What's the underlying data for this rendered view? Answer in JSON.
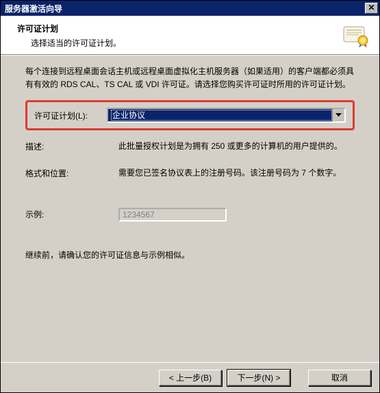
{
  "window": {
    "title": "服务器激活向导",
    "close": "✕"
  },
  "header": {
    "title": "许可证计划",
    "subtitle": "选择适当的许可证计划。"
  },
  "intro": "每个连接到远程桌面会话主机或远程桌面虚拟化主机服务器（如果适用）的客户端都必须具有有效的 RDS CAL、TS CAL 或 VDI 许可证。请选择您购买许可证时所用的许可证计划。",
  "licensePlan": {
    "label": "许可证计划(L):",
    "selected": "企业协议"
  },
  "description": {
    "label": "描述:",
    "value": "此批量授权计划是为拥有 250 或更多的计算机的用户提供的。"
  },
  "format": {
    "label": "格式和位置:",
    "value": "需要您已签名协议表上的注册号码。该注册号码为 7 个数字。"
  },
  "example": {
    "label": "示例:",
    "value": "1234567"
  },
  "confirm": "继续前，请确认您的许可证信息与示例相似。",
  "buttons": {
    "back": "< 上一步(B)",
    "next": "下一步(N) >",
    "cancel": "取消"
  }
}
